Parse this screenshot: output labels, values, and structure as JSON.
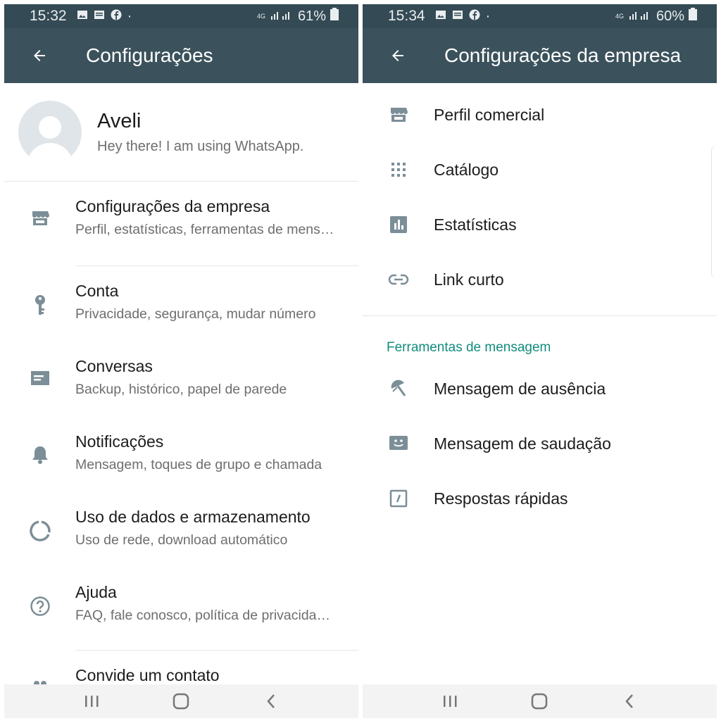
{
  "colors": {
    "statusbar": "#344a54",
    "appbar": "#3b525c",
    "accent": "#128c7e",
    "icon": "#7c8e97"
  },
  "left": {
    "status": {
      "time": "15:32",
      "network": "4G",
      "battery": "61%"
    },
    "appbar": {
      "title": "Configurações",
      "back_icon": "arrow-back-icon"
    },
    "profile": {
      "name": "Aveli",
      "status": "Hey there! I am using WhatsApp."
    },
    "settings": [
      {
        "title": "Configurações da empresa",
        "subtitle": "Perfil, estatísticas, ferramentas de mens…",
        "icon": "store-icon"
      },
      {
        "title": "Conta",
        "subtitle": "Privacidade, segurança, mudar número",
        "icon": "key-icon"
      },
      {
        "title": "Conversas",
        "subtitle": "Backup, histórico, papel de parede",
        "icon": "chat-icon"
      },
      {
        "title": "Notificações",
        "subtitle": "Mensagem, toques de grupo e chamada",
        "icon": "bell-icon"
      },
      {
        "title": "Uso de dados e armazenamento",
        "subtitle": "Uso de rede, download automático",
        "icon": "data-usage-icon"
      },
      {
        "title": "Ajuda",
        "subtitle": "FAQ, fale conosco, política de privacida…",
        "icon": "help-icon"
      },
      {
        "title": "Convide um contato",
        "icon": "people-icon"
      }
    ]
  },
  "right": {
    "status": {
      "time": "15:34",
      "network": "4G",
      "battery": "60%"
    },
    "appbar": {
      "title": "Configurações da empresa",
      "back_icon": "arrow-back-icon"
    },
    "items": [
      {
        "title": "Perfil comercial",
        "icon": "store-icon"
      },
      {
        "title": "Catálogo",
        "icon": "grid-icon"
      },
      {
        "title": "Estatísticas",
        "icon": "bar-chart-icon"
      },
      {
        "title": "Link curto",
        "icon": "link-icon"
      }
    ],
    "section_header": "Ferramentas de mensagem",
    "tools": [
      {
        "title": "Mensagem de ausência",
        "icon": "beach-icon"
      },
      {
        "title": "Mensagem de saudação",
        "icon": "smile-message-icon"
      },
      {
        "title": "Respostas rápidas",
        "icon": "quick-reply-icon"
      }
    ]
  }
}
